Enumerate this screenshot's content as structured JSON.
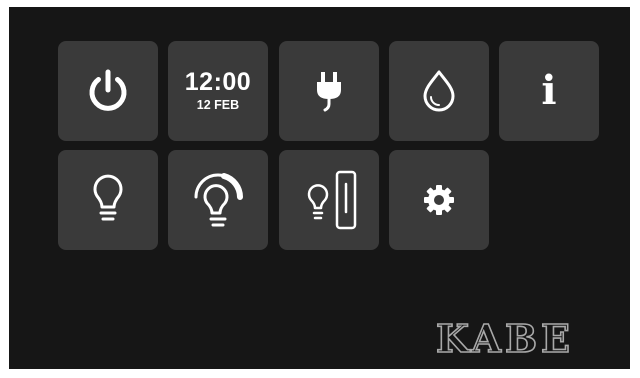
{
  "tiles": [
    {
      "name": "power",
      "icon": "power-icon"
    },
    {
      "name": "clock",
      "time": "12:00",
      "date": "12 FEB"
    },
    {
      "name": "power-plug",
      "icon": "plug-icon"
    },
    {
      "name": "water",
      "icon": "water-drop-icon"
    },
    {
      "name": "info",
      "icon": "info-icon",
      "glyph": "i"
    },
    {
      "name": "light",
      "icon": "light-bulb-icon"
    },
    {
      "name": "light-dimmer",
      "icon": "light-dimmer-icon"
    },
    {
      "name": "light-slider",
      "icon": "light-slider-icon"
    },
    {
      "name": "settings",
      "icon": "gear-icon"
    }
  ],
  "brand": {
    "logo_text": "KABE"
  },
  "colors": {
    "background": "#161616",
    "tile": "#3a3a3a",
    "icon": "#ffffff"
  }
}
